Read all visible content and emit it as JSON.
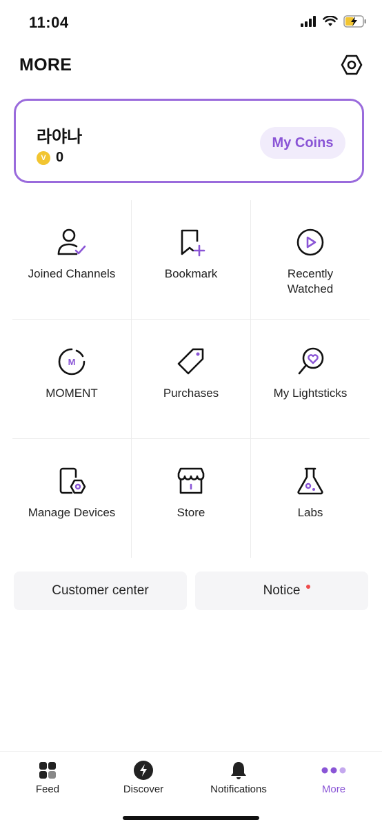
{
  "status_bar": {
    "time": "11:04"
  },
  "header": {
    "title": "MORE"
  },
  "profile": {
    "name": "라야나",
    "coins": "0",
    "coin_icon_letter": "V",
    "my_coins_label": "My Coins"
  },
  "menu": [
    {
      "label": "Joined Channels",
      "icon": "joined-channels-icon"
    },
    {
      "label": "Bookmark",
      "icon": "bookmark-icon"
    },
    {
      "label": "Recently Watched",
      "icon": "recently-watched-icon"
    },
    {
      "label": "MOMENT",
      "icon": "moment-icon",
      "icon_letter": "M"
    },
    {
      "label": "Purchases",
      "icon": "purchases-tag-icon"
    },
    {
      "label": "My Lightsticks",
      "icon": "lightstick-icon"
    },
    {
      "label": "Manage Devices",
      "icon": "manage-devices-icon"
    },
    {
      "label": "Store",
      "icon": "store-icon"
    },
    {
      "label": "Labs",
      "icon": "labs-flask-icon"
    }
  ],
  "bottom_buttons": {
    "customer_center": "Customer center",
    "notice": "Notice"
  },
  "tabbar": {
    "items": [
      {
        "label": "Feed",
        "icon": "feed-icon"
      },
      {
        "label": "Discover",
        "icon": "discover-icon"
      },
      {
        "label": "Notifications",
        "icon": "bell-icon"
      },
      {
        "label": "More",
        "icon": "more-dots-icon",
        "active": true
      }
    ]
  },
  "colors": {
    "accent": "#8a55d6",
    "card_border": "#9a6bdc",
    "coin": "#f2c531",
    "notice_dot": "#ef4b4b"
  }
}
